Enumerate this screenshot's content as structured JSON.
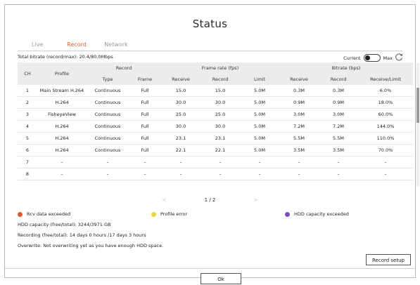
{
  "title": "Status",
  "tabs": [
    {
      "label": "Live"
    },
    {
      "label": "Record"
    },
    {
      "label": "Network"
    }
  ],
  "bitrate_text": "Total bitrate (record/max): 20.4/80.0Mbps",
  "toggle": {
    "left_label": "Current",
    "right_label": "Max"
  },
  "table": {
    "header_top": {
      "ch": "CH",
      "profile": "Profile",
      "record": "Record",
      "frame_rate": "Frame rate (fps)",
      "bitrate": "Bitrate (bps)"
    },
    "header_sub": {
      "type": "Type",
      "frame": "Frame",
      "fr_receive": "Receive",
      "fr_record": "Record",
      "limit": "Limit",
      "br_receive": "Receive",
      "br_record": "Record",
      "receive_limit": "Receive/Limit"
    },
    "rows": [
      {
        "ch": "1",
        "profile": "Main Stream H.264",
        "type": "Continuous",
        "frame": "Full",
        "fr_receive": "15.0",
        "fr_record": "15.0",
        "limit": "5.0M",
        "br_receive": "0.3M",
        "br_record": "0.3M",
        "receive_limit": "6.0%"
      },
      {
        "ch": "2",
        "profile": "H.264",
        "type": "Continuous",
        "frame": "Full",
        "fr_receive": "30.0",
        "fr_record": "30.0",
        "limit": "5.0M",
        "br_receive": "0.9M",
        "br_record": "0.9M",
        "receive_limit": "18.0%"
      },
      {
        "ch": "3",
        "profile": "FisheyeView",
        "type": "Continuous",
        "frame": "Full",
        "fr_receive": "25.0",
        "fr_record": "25.0",
        "limit": "5.0M",
        "br_receive": "3.0M",
        "br_record": "3.0M",
        "receive_limit": "60.0%"
      },
      {
        "ch": "4",
        "profile": "H.264",
        "type": "Continuous",
        "frame": "Full",
        "fr_receive": "30.0",
        "fr_record": "30.0",
        "limit": "5.0M",
        "br_receive": "7.2M",
        "br_record": "7.2M",
        "receive_limit": "144.0%"
      },
      {
        "ch": "5",
        "profile": "H.264",
        "type": "Continuous",
        "frame": "Full",
        "fr_receive": "23.1",
        "fr_record": "23.1",
        "limit": "5.0M",
        "br_receive": "5.5M",
        "br_record": "5.5M",
        "receive_limit": "110.0%"
      },
      {
        "ch": "6",
        "profile": "H.264",
        "type": "Continuous",
        "frame": "Full",
        "fr_receive": "22.1",
        "fr_record": "22.1",
        "limit": "5.0M",
        "br_receive": "3.5M",
        "br_record": "3.5M",
        "receive_limit": "70.0%"
      },
      {
        "ch": "7",
        "profile": "–",
        "type": "–",
        "frame": "–",
        "fr_receive": "–",
        "fr_record": "–",
        "limit": "–",
        "br_receive": "–",
        "br_record": "–",
        "receive_limit": "–"
      },
      {
        "ch": "8",
        "profile": "–",
        "type": "–",
        "frame": "–",
        "fr_receive": "–",
        "fr_record": "–",
        "limit": "–",
        "br_receive": "–",
        "br_record": "–",
        "receive_limit": "–"
      }
    ]
  },
  "pagination": {
    "prev": "<",
    "page": "1 / 2",
    "next": ">"
  },
  "legend": [
    {
      "label": "Rcv data exceeded",
      "color": "#e8582a"
    },
    {
      "label": "Profile error",
      "color": "#e8d93a"
    },
    {
      "label": "HDD capacity exceeded",
      "color": "#7d4cc2"
    }
  ],
  "info": {
    "hdd": "HDD capacity (free/total): 3244/3971 GB",
    "recording": "Recording (free/total): 14 days 0 hours /17 days 3 hours",
    "overwrite": "Overwrite: Not overwriting yet as you have enough HDD space."
  },
  "buttons": {
    "record_setup": "Record setup",
    "ok": "Ok"
  }
}
